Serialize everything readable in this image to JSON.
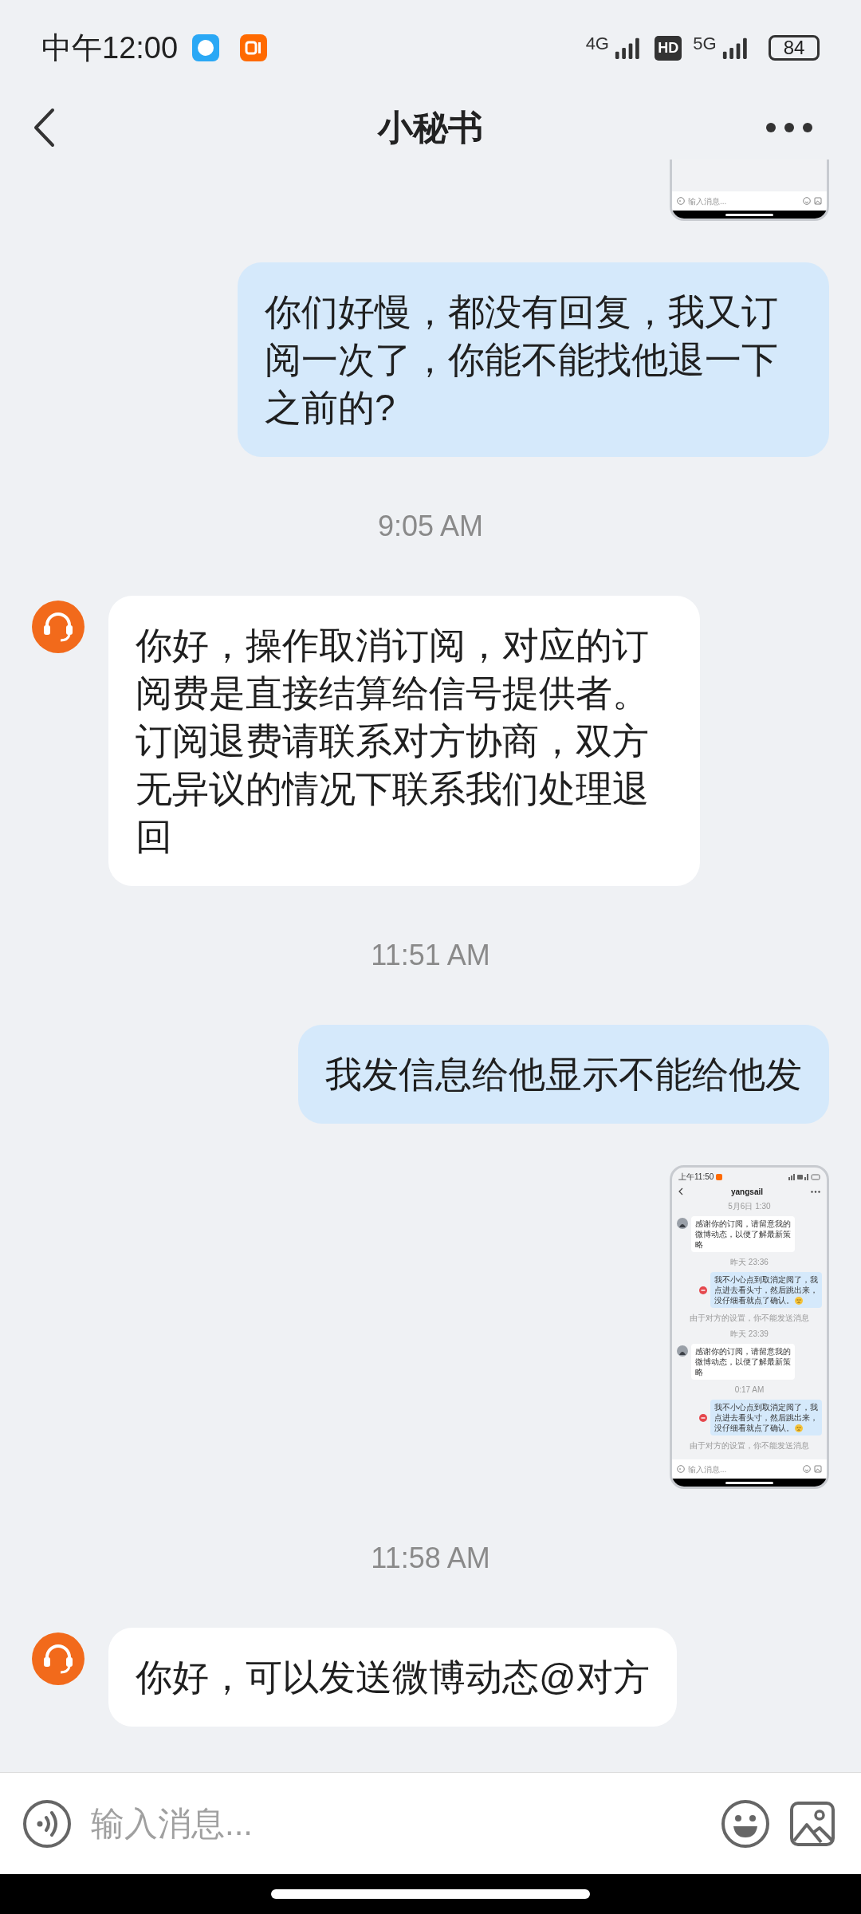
{
  "status_bar": {
    "time": "中午12:00",
    "network_1": "4G",
    "hd": "HD",
    "network_2": "5G",
    "battery": "84"
  },
  "header": {
    "title": "小秘书"
  },
  "messages": [
    {
      "kind": "screenshot",
      "input_placeholder": "输入消息..."
    },
    {
      "kind": "outgoing",
      "text": "你们好慢，都没有回复，我又订阅一次了，你能不能找他退一下之前的?"
    },
    {
      "kind": "time",
      "text": "9:05 AM"
    },
    {
      "kind": "incoming",
      "text": "你好，操作取消订阅，对应的订阅费是直接结算给信号提供者。订阅退费请联系对方协商，双方无异议的情况下联系我们处理退回"
    },
    {
      "kind": "time",
      "text": "11:51 AM"
    },
    {
      "kind": "outgoing",
      "text": "我发信息给他显示不能给他发"
    },
    {
      "kind": "screenshot",
      "status_time": "上午11:50",
      "title": "yangsail",
      "input_placeholder": "输入消息...",
      "items": [
        {
          "kind": "time",
          "text": "5月6日 1:30"
        },
        {
          "kind": "incoming",
          "text": "感谢你的订阅，请留意我的微博动态，以便了解最新策略"
        },
        {
          "kind": "time",
          "text": "昨天 23:36"
        },
        {
          "kind": "outgoing",
          "text": "我不小心点到取消定阅了，我点进去看头寸，然后跳出来，没仔细看就点了确认。",
          "emoji": true
        },
        {
          "kind": "notice",
          "text": "由于对方的设置，你不能发送消息"
        },
        {
          "kind": "time",
          "text": "昨天 23:39"
        },
        {
          "kind": "incoming",
          "text": "感谢你的订阅，请留意我的微博动态，以便了解最新策略"
        },
        {
          "kind": "time",
          "text": "0:17 AM"
        },
        {
          "kind": "outgoing",
          "text": "我不小心点到取消定阅了，我点进去看头寸，然后跳出来，没仔细看就点了确认。",
          "emoji": true
        },
        {
          "kind": "notice",
          "text": "由于对方的设置，你不能发送消息"
        }
      ]
    },
    {
      "kind": "time",
      "text": "11:58 AM"
    },
    {
      "kind": "incoming",
      "text": "你好，可以发送微博动态@对方"
    }
  ],
  "composer": {
    "placeholder": "输入消息..."
  }
}
